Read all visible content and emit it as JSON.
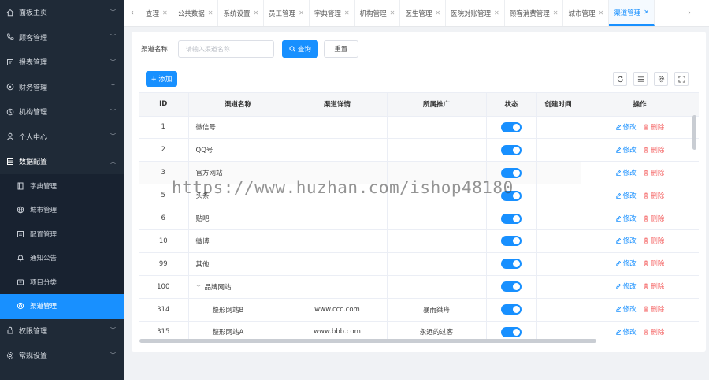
{
  "sidebar": {
    "items": [
      {
        "label": "面板主页",
        "icon": "home-icon",
        "open": false
      },
      {
        "label": "顾客管理",
        "icon": "phone-icon",
        "open": false
      },
      {
        "label": "报表管理",
        "icon": "report-icon",
        "open": false
      },
      {
        "label": "财务管理",
        "icon": "finance-icon",
        "open": false
      },
      {
        "label": "机构管理",
        "icon": "institution-icon",
        "open": false
      },
      {
        "label": "个人中心",
        "icon": "user-icon",
        "open": false
      },
      {
        "label": "数据配置",
        "icon": "data-config-icon",
        "open": true
      }
    ],
    "sub_items": [
      {
        "label": "字典管理",
        "icon": "dictionary-icon"
      },
      {
        "label": "城市管理",
        "icon": "globe-icon"
      },
      {
        "label": "配置管理",
        "icon": "config-icon"
      },
      {
        "label": "通知公告",
        "icon": "bell-icon"
      },
      {
        "label": "项目分类",
        "icon": "category-icon"
      },
      {
        "label": "渠道管理",
        "icon": "channel-icon",
        "active": true
      }
    ],
    "bottom_items": [
      {
        "label": "权限管理",
        "icon": "lock-icon"
      },
      {
        "label": "常规设置",
        "icon": "gear-icon"
      }
    ]
  },
  "tabs": [
    {
      "label": "查理"
    },
    {
      "label": "公共数据"
    },
    {
      "label": "系统设置"
    },
    {
      "label": "员工管理"
    },
    {
      "label": "字典管理"
    },
    {
      "label": "机构管理"
    },
    {
      "label": "医生管理"
    },
    {
      "label": "医院对账管理"
    },
    {
      "label": "顾客消费管理"
    },
    {
      "label": "城市管理"
    },
    {
      "label": "渠道管理",
      "active": true
    }
  ],
  "search": {
    "label": "渠道名称:",
    "placeholder": "请输入渠道名称",
    "query_label": "查询",
    "reset_label": "重置"
  },
  "toolbar": {
    "add_label": "+ 添加"
  },
  "table": {
    "columns": [
      "ID",
      "渠道名称",
      "渠道详情",
      "所属推广",
      "状态",
      "创建时间",
      "操作"
    ],
    "edit_label": "修改",
    "delete_label": "删除",
    "rows": [
      {
        "id": "1",
        "name": "微信号",
        "detail": "",
        "promo": "",
        "child": false,
        "expand": false
      },
      {
        "id": "2",
        "name": "QQ号",
        "detail": "",
        "promo": "",
        "child": false,
        "expand": false
      },
      {
        "id": "3",
        "name": "官方网站",
        "detail": "",
        "promo": "",
        "child": false,
        "expand": false
      },
      {
        "id": "5",
        "name": "头条",
        "detail": "",
        "promo": "",
        "child": false,
        "expand": false
      },
      {
        "id": "6",
        "name": "贴吧",
        "detail": "",
        "promo": "",
        "child": false,
        "expand": false
      },
      {
        "id": "10",
        "name": "微博",
        "detail": "",
        "promo": "",
        "child": false,
        "expand": false
      },
      {
        "id": "99",
        "name": "其他",
        "detail": "",
        "promo": "",
        "child": false,
        "expand": false
      },
      {
        "id": "100",
        "name": "品牌网站",
        "detail": "",
        "promo": "",
        "child": false,
        "expand": true
      },
      {
        "id": "314",
        "name": "整形网站B",
        "detail": "www.ccc.com",
        "promo": "暴雨桀舟",
        "child": true,
        "expand": false
      },
      {
        "id": "315",
        "name": "整形网站A",
        "detail": "www.bbb.com",
        "promo": "永远的过客",
        "child": true,
        "expand": false
      }
    ]
  },
  "watermark": "https://www.huzhan.com/ishop48180",
  "colors": {
    "accent": "#1890ff",
    "sidebar_bg": "#1f2a37",
    "danger": "#f56c6c"
  }
}
